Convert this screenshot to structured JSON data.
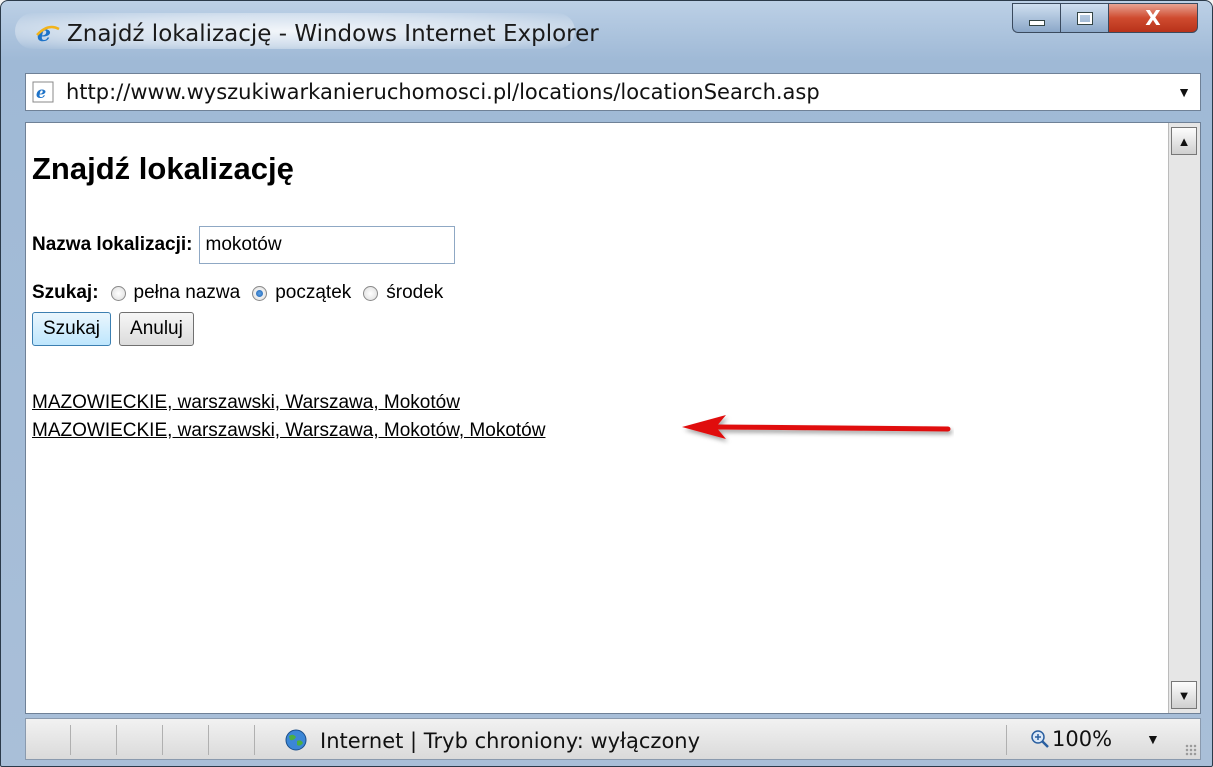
{
  "window": {
    "title": "Znajdź lokalizację - Windows Internet Explorer",
    "icon": "ie-icon",
    "controls": {
      "minimize": "minimize-icon",
      "maximize": "maximize-icon",
      "close_label": "X"
    }
  },
  "address": {
    "url": "http://www.wyszukiwarkanieruchomosci.pl/locations/locationSearch.asp",
    "dropdown": "▼"
  },
  "page": {
    "heading": "Znajdź lokalizację",
    "location_label": "Nazwa lokalizacji:",
    "location_value": "mokotów",
    "search_label": "Szukaj:",
    "options": [
      "pełna nazwa",
      "początek",
      "środek"
    ],
    "selected_option": "początek",
    "search_button": "Szukaj",
    "cancel_button": "Anuluj",
    "results": [
      "MAZOWIECKIE, warszawski, Warszawa, Mokotów",
      "MAZOWIECKIE, warszawski, Warszawa, Mokotów, Mokotów"
    ],
    "annotation": {
      "type": "arrow",
      "color": "#e01010",
      "points_to": "results.1"
    }
  },
  "scrollbar": {
    "up": "▲",
    "down": "▼"
  },
  "status": {
    "zone_text": "Internet | Tryb chroniony: wyłączony",
    "zoom": "100%",
    "zoom_dropdown": "▼"
  }
}
